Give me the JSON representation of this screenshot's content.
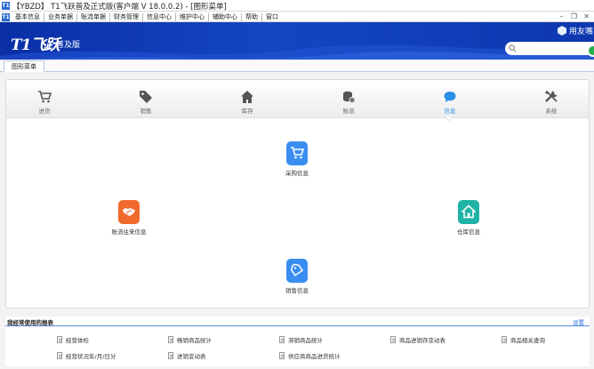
{
  "window": {
    "title": "【YBZD】 T1飞跃普及正式版(客户端 V 18.0.0.2) - [图形菜单]",
    "app_icon": "T1"
  },
  "menubar": {
    "app_icon": "T1",
    "items": [
      "基本信息",
      "业务单据",
      "账流单据",
      "财务管理",
      "信息中心",
      "维护中心",
      "辅助中心",
      "帮助",
      "窗口"
    ],
    "window_controls": [
      "minimize-icon",
      "restore-icon",
      "close-icon"
    ]
  },
  "banner": {
    "logo": "T1飞跃",
    "edition": "普及版",
    "user": "用友嘴"
  },
  "tabs": [
    {
      "label": "图形菜单",
      "active": true
    }
  ],
  "nav": [
    {
      "label": "进货",
      "icon": "cart-icon"
    },
    {
      "label": "销售",
      "icon": "tag-icon"
    },
    {
      "label": "库存",
      "icon": "house-icon"
    },
    {
      "label": "账流",
      "icon": "coins-icon"
    },
    {
      "label": "信息",
      "icon": "chat-icon",
      "active": true
    },
    {
      "label": "系统",
      "icon": "tools-icon"
    }
  ],
  "diagram": {
    "top": {
      "label": "采购信息",
      "color": "#3a8ef0",
      "icon": "cart-icon"
    },
    "left": {
      "label": "账流往来信息",
      "color": "#f06a2c",
      "icon": "handshake-icon"
    },
    "right": {
      "label": "仓库信息",
      "color": "#1fb3a6",
      "icon": "house-icon"
    },
    "bottom": {
      "label": "销售信息",
      "color": "#3a8ef0",
      "icon": "tag-icon"
    }
  },
  "reports": {
    "title": "我经常使用的报表",
    "settings_label": "设置",
    "items": [
      "经营体检",
      "畅销商品统计",
      "滞销商品统计",
      "商品进销存变动表",
      "商品相关查询",
      "经营状况年/月/日分",
      "进销变动表",
      "供应商商品进货统计"
    ]
  },
  "colors": {
    "accent": "#2b8fe8",
    "banner": "#1446c2"
  }
}
